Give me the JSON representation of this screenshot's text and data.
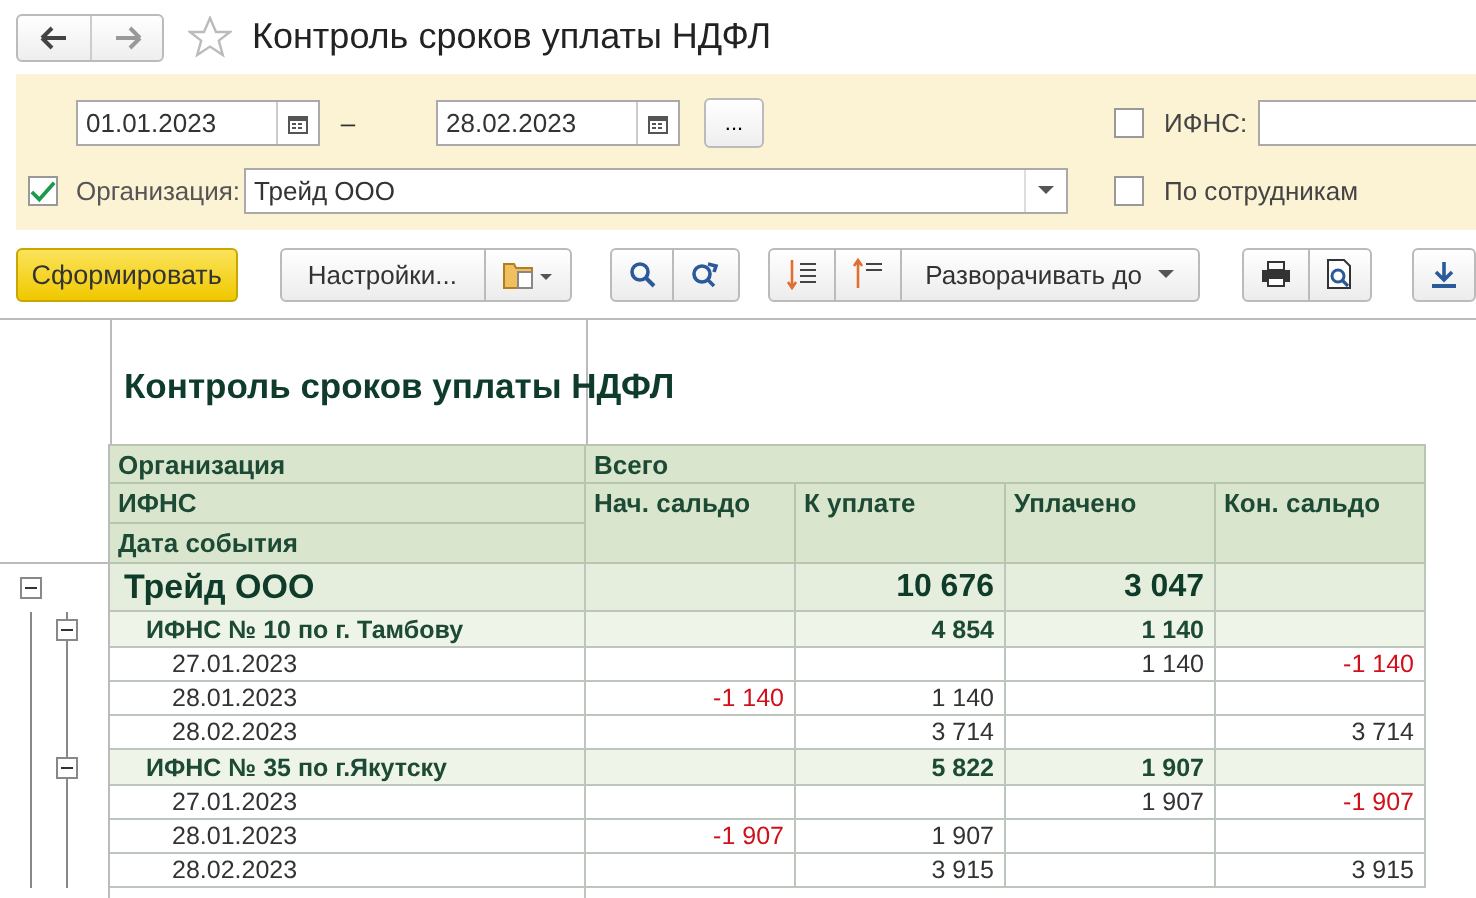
{
  "window": {
    "title": "Контроль сроков уплаты НДФЛ"
  },
  "filters": {
    "date_from": "01.01.2023",
    "date_to": "28.02.2023",
    "dash": "–",
    "period_button": "...",
    "organization": {
      "checked": true,
      "label": "Организация:",
      "value": "Трейд ООО"
    },
    "ifns": {
      "checked": false,
      "label": "ИФНС:"
    },
    "by_employees": {
      "checked": false,
      "label": "По сотрудникам"
    }
  },
  "toolbar": {
    "generate": "Сформировать",
    "settings": "Настройки...",
    "expand": "Разворачивать до"
  },
  "report": {
    "title": "Контроль сроков уплаты НДФЛ",
    "header": {
      "grouping": [
        "Организация",
        "ИФНС",
        "Дата события"
      ],
      "total": "Всего",
      "columns": [
        "Нач. сальдо",
        "К уплате",
        "Уплачено",
        "Кон. сальдо"
      ]
    },
    "rows": [
      {
        "kind": "organization",
        "label": "Трейд ООО",
        "expanded": true,
        "due": {
          "text": "10 676",
          "negative": false
        },
        "paid": {
          "text": "3 047",
          "negative": false
        },
        "children": [
          {
            "kind": "ifns",
            "label": "ИФНС № 10 по г. Тамбову",
            "expanded": true,
            "due": {
              "text": "4 854",
              "negative": false
            },
            "paid": {
              "text": "1 140",
              "negative": false
            },
            "children": [
              {
                "kind": "date",
                "label": "27.01.2023",
                "paid": {
                  "text": "1 140",
                  "negative": false
                },
                "closing": {
                  "text": "-1 140",
                  "negative": true
                }
              },
              {
                "kind": "date",
                "label": "28.01.2023",
                "opening": {
                  "text": "-1 140",
                  "negative": true
                },
                "due": {
                  "text": "1 140",
                  "negative": false
                }
              },
              {
                "kind": "date",
                "label": "28.02.2023",
                "due": {
                  "text": "3 714",
                  "negative": false
                },
                "closing": {
                  "text": "3 714",
                  "negative": false
                }
              }
            ]
          },
          {
            "kind": "ifns",
            "label": "ИФНС № 35 по г.Якутску",
            "expanded": true,
            "due": {
              "text": "5 822",
              "negative": false
            },
            "paid": {
              "text": "1 907",
              "negative": false
            },
            "children": [
              {
                "kind": "date",
                "label": "27.01.2023",
                "paid": {
                  "text": "1 907",
                  "negative": false
                },
                "closing": {
                  "text": "-1 907",
                  "negative": true
                }
              },
              {
                "kind": "date",
                "label": "28.01.2023",
                "opening": {
                  "text": "-1 907",
                  "negative": true
                },
                "due": {
                  "text": "1 907",
                  "negative": false
                }
              },
              {
                "kind": "date",
                "label": "28.02.2023",
                "due": {
                  "text": "3 915",
                  "negative": false
                },
                "closing": {
                  "text": "3 915",
                  "negative": false
                }
              }
            ]
          }
        ]
      }
    ]
  }
}
